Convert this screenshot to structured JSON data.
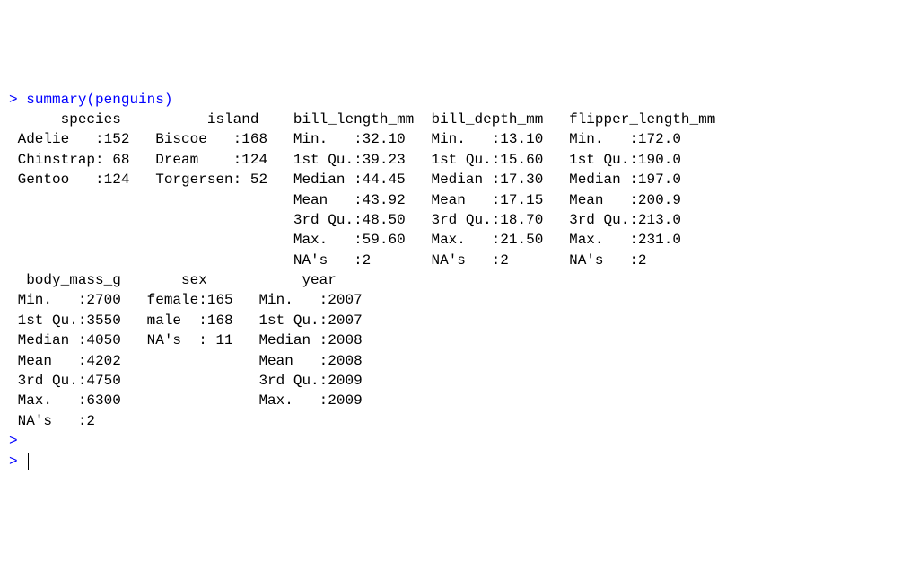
{
  "prompt_char": ">",
  "command": "summary(penguins)",
  "headers_row1": "      species          island    bill_length_mm  bill_depth_mm   flipper_length_mm",
  "row1_1": " Adelie   :152   Biscoe   :168   Min.   :32.10   Min.   :13.10   Min.   :172.0    ",
  "row1_2": " Chinstrap: 68   Dream    :124   1st Qu.:39.23   1st Qu.:15.60   1st Qu.:190.0    ",
  "row1_3": " Gentoo   :124   Torgersen: 52   Median :44.45   Median :17.30   Median :197.0    ",
  "row1_4": "                                 Mean   :43.92   Mean   :17.15   Mean   :200.9    ",
  "row1_5": "                                 3rd Qu.:48.50   3rd Qu.:18.70   3rd Qu.:213.0    ",
  "row1_6": "                                 Max.   :59.60   Max.   :21.50   Max.   :231.0    ",
  "row1_7": "                                 NA's   :2       NA's   :2       NA's   :2        ",
  "headers_row2": "  body_mass_g       sex           year     ",
  "row2_1": " Min.   :2700   female:165   Min.   :2007  ",
  "row2_2": " 1st Qu.:3550   male  :168   1st Qu.:2007  ",
  "row2_3": " Median :4050   NA's  : 11   Median :2008  ",
  "row2_4": " Mean   :4202                Mean   :2008  ",
  "row2_5": " 3rd Qu.:4750                3rd Qu.:2009  ",
  "row2_6": " Max.   :6300                Max.   :2009  ",
  "row2_7": " NA's   :2                                 "
}
